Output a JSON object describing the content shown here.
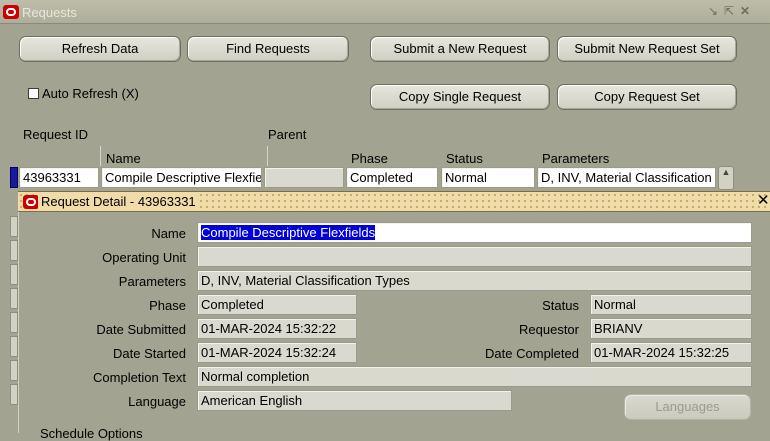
{
  "window": {
    "title": "Requests"
  },
  "toolbar": {
    "refresh": "Refresh Data",
    "find": "Find Requests",
    "submit_new": "Submit a New Request",
    "submit_set": "Submit New Request Set",
    "copy_single": "Copy Single Request",
    "copy_set": "Copy Request Set"
  },
  "auto_refresh": {
    "label": "Auto Refresh (X)",
    "checked": false
  },
  "columns": {
    "request_id": "Request ID",
    "parent": "Parent",
    "name": "Name",
    "phase": "Phase",
    "status": "Status",
    "parameters": "Parameters"
  },
  "rows": [
    {
      "request_id": "43963331",
      "name": "Compile Descriptive Flexfie",
      "parent": "",
      "phase": "Completed",
      "status": "Normal",
      "parameters": "D, INV, Material Classification"
    }
  ],
  "detail": {
    "title": "Request Detail - 43963331",
    "labels": {
      "name": "Name",
      "operating_unit": "Operating Unit",
      "parameters": "Parameters",
      "phase": "Phase",
      "status": "Status",
      "date_submitted": "Date Submitted",
      "requestor": "Requestor",
      "date_started": "Date Started",
      "date_completed": "Date Completed",
      "completion_text": "Completion Text",
      "language": "Language"
    },
    "values": {
      "name": "Compile Descriptive Flexfields",
      "operating_unit": "",
      "parameters": "D, INV, Material Classification Types",
      "phase": "Completed",
      "status": "Normal",
      "date_submitted": "01-MAR-2024 15:32:22",
      "requestor": "BRIANV",
      "date_started": "01-MAR-2024 15:32:24",
      "date_completed": "01-MAR-2024 15:32:25",
      "completion_text": "Normal completion",
      "language": "American English"
    },
    "languages_button": "Languages",
    "partial_label": "Schedule Options"
  }
}
